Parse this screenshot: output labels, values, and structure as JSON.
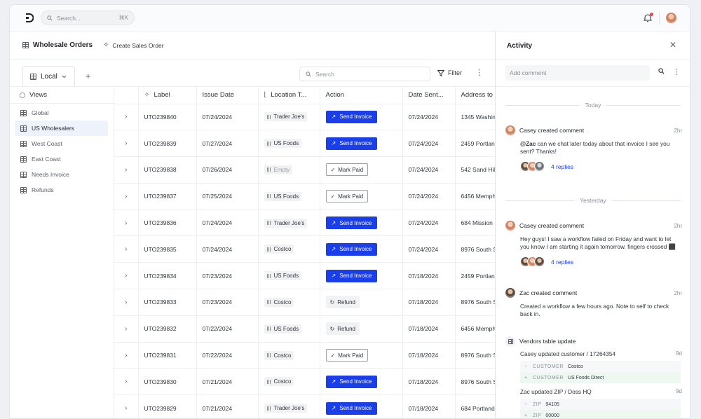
{
  "topbar": {
    "search_placeholder": "Search...",
    "search_shortcut": "⌘K"
  },
  "page": {
    "title": "Wholesale Orders",
    "create_label": "Create Sales Order"
  },
  "tabs": {
    "local_label": "Local",
    "add": "+"
  },
  "table_toolbar": {
    "search_placeholder": "Search",
    "filter_label": "Filter"
  },
  "views": {
    "header": "Views",
    "items": [
      "Global",
      "US Wholesalers",
      "West Coast",
      "East Coast",
      "Needs Invoice",
      "Refunds"
    ]
  },
  "columns": [
    "Label",
    "Issue Date",
    "Location T...",
    "Action",
    "Date Sent...",
    "Address to"
  ],
  "rows": [
    {
      "label": "UTO239840",
      "issue": "07/24/2024",
      "location": "Trader Joe's",
      "action": "Send Invoice",
      "action_type": "send",
      "sent": "07/24/2024",
      "address": "1345 Washin"
    },
    {
      "label": "UTO239839",
      "issue": "07/27/2024",
      "location": "US Foods",
      "action": "Send Invoice",
      "action_type": "send",
      "sent": "07/24/2024",
      "address": "2459 Portlan"
    },
    {
      "label": "UTO239838",
      "issue": "07/26/2024",
      "location": "Empty",
      "action": "Mark Paid",
      "action_type": "paid",
      "sent": "07/24/2024",
      "address": "542 Sand Hil"
    },
    {
      "label": "UTO239837",
      "issue": "07/25/2024",
      "location": "US Foods",
      "action": "Mark Paid",
      "action_type": "paid",
      "sent": "07/24/2024",
      "address": "6456 Memph"
    },
    {
      "label": "UTO239836",
      "issue": "07/24/2024",
      "location": "Trader Joe's",
      "action": "Send Invoice",
      "action_type": "send",
      "sent": "07/24/2024",
      "address": "684 Mission"
    },
    {
      "label": "UTO239835",
      "issue": "07/24/2024",
      "location": "Costco",
      "action": "Send Invoice",
      "action_type": "send",
      "sent": "07/24/2024",
      "address": "8976 South S"
    },
    {
      "label": "UTO239834",
      "issue": "07/23/2024",
      "location": "US Foods",
      "action": "Send Invoice",
      "action_type": "send",
      "sent": "07/18/2024",
      "address": "2459 Portlan"
    },
    {
      "label": "UTO239833",
      "issue": "07/23/2024",
      "location": "Costco",
      "action": "Refund",
      "action_type": "refund",
      "sent": "07/18/2024",
      "address": "8976 South S"
    },
    {
      "label": "UTO239832",
      "issue": "07/22/2024",
      "location": "US Foods",
      "action": "Refund",
      "action_type": "refund",
      "sent": "07/18/2024",
      "address": "6456 Memph"
    },
    {
      "label": "UTO239831",
      "issue": "07/22/2024",
      "location": "Costco",
      "action": "Mark Paid",
      "action_type": "paid",
      "sent": "07/18/2024",
      "address": "8976 South S"
    },
    {
      "label": "UTO239830",
      "issue": "07/21/2024",
      "location": "Costco",
      "action": "Send Invoice",
      "action_type": "send",
      "sent": "07/18/2024",
      "address": "8976 South S"
    },
    {
      "label": "UTO239829",
      "issue": "07/21/2024",
      "location": "Trader Joe's",
      "action": "Send Invoice",
      "action_type": "send",
      "sent": "07/18/2024",
      "address": "684 Portland"
    }
  ],
  "activity": {
    "title": "Activity",
    "add_comment_placeholder": "Add comment",
    "today_label": "Today",
    "yesterday_label": "Yesterday",
    "c1": {
      "author_action": "Casey created comment",
      "time": "2hr",
      "mention": "@Zac",
      "text": " can we chat later today about that invoice I see you sent? Thanks!",
      "replies": "4 replies"
    },
    "c2": {
      "author_action": "Casey created comment",
      "time": "2hr",
      "text": "Hey guys! I saw a workflow failed on Friday and want to let you know I am starting it again tomorrow. fingers crossed ⬛",
      "replies": "4 replies"
    },
    "c3": {
      "author_action": "Zac created comment",
      "time": "2hr",
      "text": "Created a workflow a few hours ago. Note to self to check back in."
    },
    "vendors": {
      "title": "Vendors table update",
      "u1": {
        "text": "Casey updated customer  /  17264354",
        "time": "9d",
        "key": "CUSTOMER",
        "old": "Costco",
        "new": "US Foods Direct"
      },
      "u2": {
        "text": "Zac updated ZIP  /  Doss HQ",
        "time": "9d",
        "key": "ZIP",
        "old": "94105",
        "new": "00000"
      }
    }
  }
}
